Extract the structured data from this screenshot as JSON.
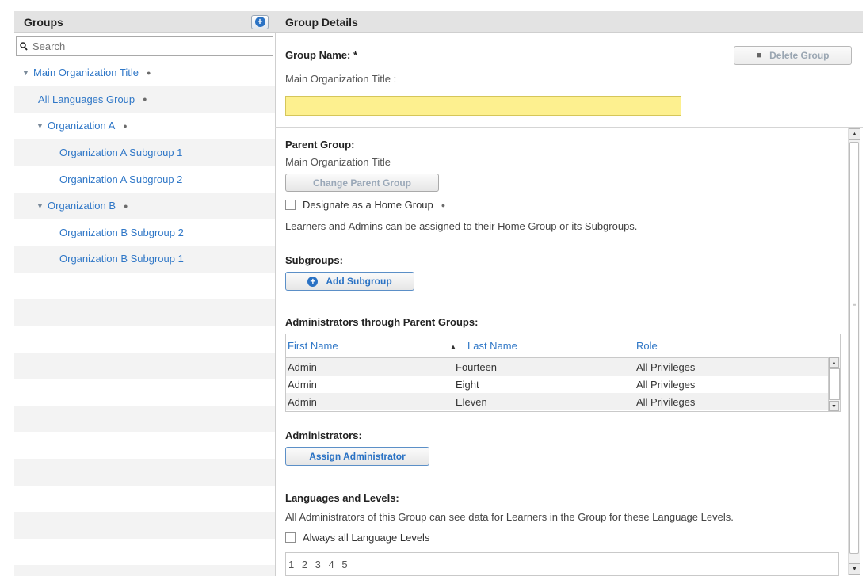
{
  "groups_panel": {
    "title": "Groups",
    "search_placeholder": "Search",
    "tree": [
      {
        "label": "Main Organization Title",
        "level": 0,
        "caret": true,
        "lock": true
      },
      {
        "label": "All Languages Group",
        "level": 1,
        "caret": false,
        "lock": true
      },
      {
        "label": "Organization A",
        "level": 1,
        "caret": true,
        "lock": true
      },
      {
        "label": "Organization A Subgroup 1",
        "level": 2,
        "caret": false,
        "lock": false
      },
      {
        "label": "Organization A Subgroup 2",
        "level": 2,
        "caret": false,
        "lock": false
      },
      {
        "label": "Organization B",
        "level": 1,
        "caret": true,
        "lock": true
      },
      {
        "label": "Organization B Subgroup 2",
        "level": 2,
        "caret": false,
        "lock": false
      },
      {
        "label": "Organization B Subgroup 1",
        "level": 2,
        "caret": false,
        "lock": false
      }
    ]
  },
  "details": {
    "title": "Group Details",
    "group_name_label": "Group Name: *",
    "group_name_parent_path": "Main Organization Title :",
    "group_name_value": "",
    "delete_button": "Delete Group",
    "parent_group_label": "Parent Group:",
    "parent_group_value": "Main Organization Title",
    "change_parent_button": "Change Parent Group",
    "home_group_checkbox": "Designate as a Home Group",
    "home_group_note": "Learners and Admins can be assigned to their Home Group or its Subgroups.",
    "subgroups_label": "Subgroups:",
    "add_subgroup_button": "Add Subgroup",
    "parent_admins_label": "Administrators through Parent Groups:",
    "admins_columns": [
      "First Name",
      "Last Name",
      "Role"
    ],
    "admins_rows": [
      [
        "Admin",
        "Fourteen",
        "All Privileges"
      ],
      [
        "Admin",
        "Eight",
        "All Privileges"
      ],
      [
        "Admin",
        "Eleven",
        "All Privileges"
      ]
    ],
    "administrators_label": "Administrators:",
    "assign_admin_button": "Assign Administrator",
    "languages_label": "Languages and Levels:",
    "languages_note": "All Administrators of this Group can see data for Learners in the Group for these Language Levels.",
    "always_all_levels_checkbox": "Always all Language Levels",
    "levels": "1 2 3 4 5"
  }
}
